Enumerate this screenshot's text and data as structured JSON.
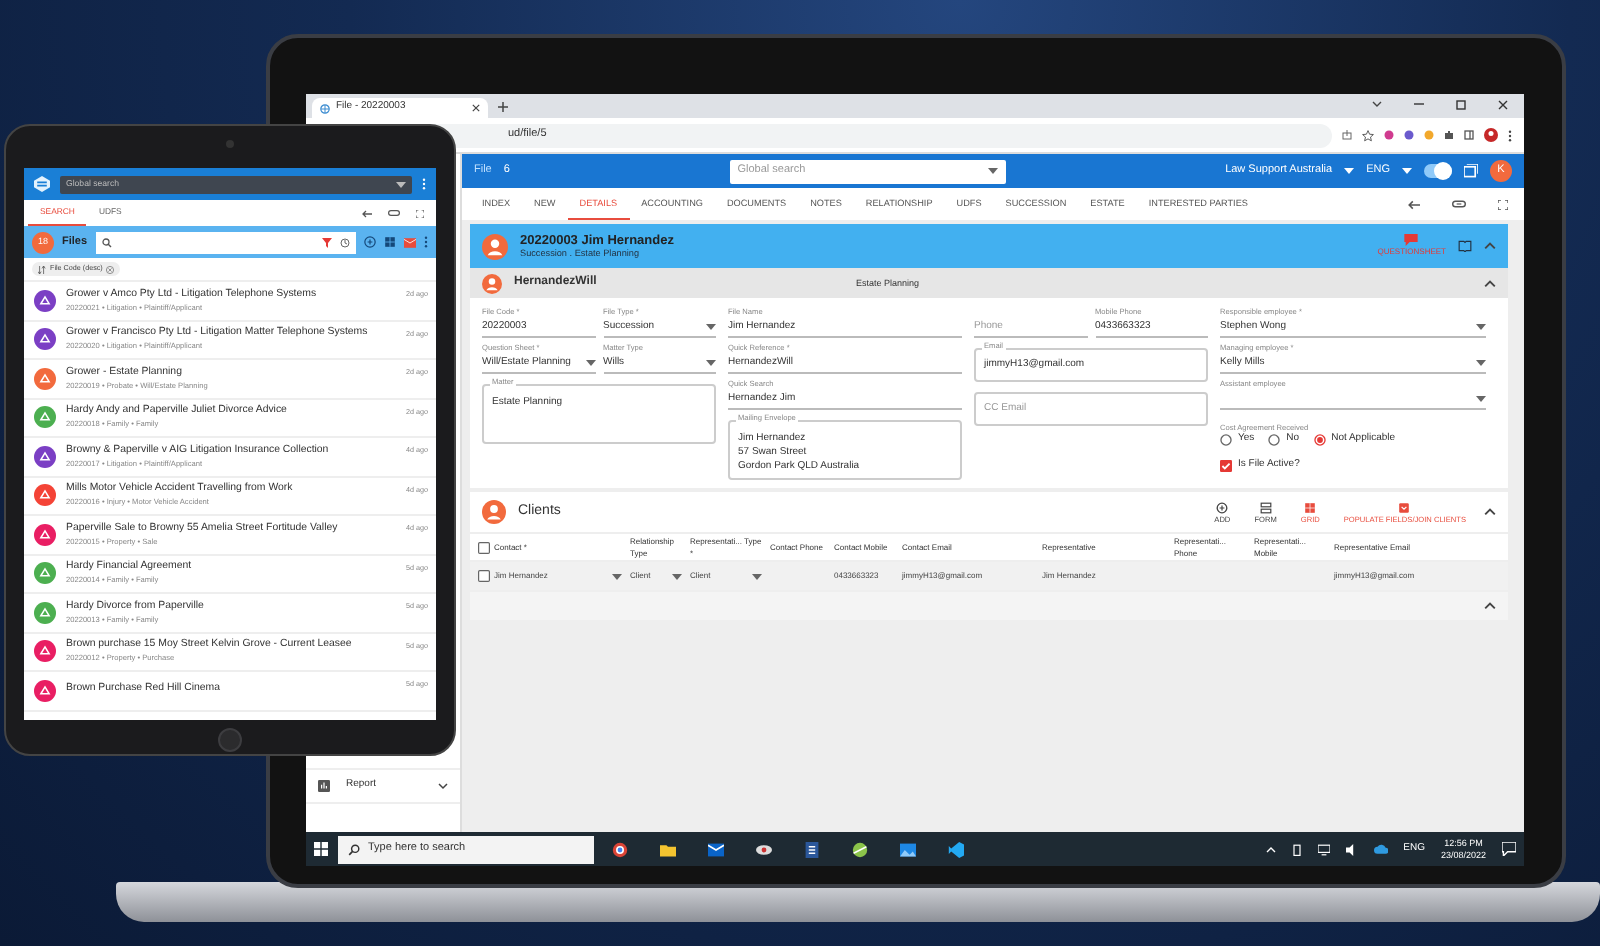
{
  "laptop": {
    "browser": {
      "tab_title": "File - 20220003",
      "address": "ud/file/5"
    },
    "app_header": {
      "title": "File",
      "count": "6",
      "search_placeholder": "Global search",
      "organization": "Law Support Australia",
      "language": "ENG",
      "toggle_on": true,
      "avatar": "K"
    },
    "tabs": [
      {
        "label": "INDEX",
        "selected": false
      },
      {
        "label": "NEW",
        "selected": false
      },
      {
        "label": "DETAILS",
        "selected": true
      },
      {
        "label": "ACCOUNTING",
        "selected": false
      },
      {
        "label": "DOCUMENTS",
        "selected": false
      },
      {
        "label": "NOTES",
        "selected": false
      },
      {
        "label": "RELATIONSHIP",
        "selected": false
      },
      {
        "label": "UDFS",
        "selected": false
      },
      {
        "label": "SUCCESSION",
        "selected": false
      },
      {
        "label": "ESTATE",
        "selected": false
      },
      {
        "label": "INTERESTED PARTIES",
        "selected": false
      }
    ],
    "file_header": {
      "title": "20220003 Jim Hernandez",
      "subtitle": "Succession . Estate Planning",
      "action": "QUESTIONSHEET"
    },
    "matter_header": {
      "title": "HernandezWill",
      "type": "Estate Planning"
    },
    "form_columns": [
      [
        {
          "kind": "pair",
          "fields": [
            {
              "kind": "line",
              "label": "File Code *",
              "value": "20220003"
            },
            {
              "kind": "select",
              "label": "File Type *",
              "value": "Succession"
            }
          ]
        },
        {
          "kind": "pair",
          "fields": [
            {
              "kind": "select",
              "label": "Question Sheet *",
              "value": "Will/Estate Planning"
            },
            {
              "kind": "select",
              "label": "Matter Type",
              "value": "Wills"
            }
          ]
        },
        {
          "kind": "textarea",
          "label": "Matter",
          "lines": [
            "Estate Planning"
          ]
        }
      ],
      [
        {
          "kind": "line",
          "label": "File Name",
          "value": "Jim Hernandez"
        },
        {
          "kind": "line",
          "label": "Quick Reference *",
          "value": "HernandezWill"
        },
        {
          "kind": "line",
          "label": "Quick Search",
          "value": "Hernandez Jim"
        },
        {
          "kind": "textarea",
          "label": "Mailing Envelope",
          "lines": [
            "Jim Hernandez",
            "57 Swan Street",
            "Gordon Park QLD Australia"
          ]
        }
      ],
      [
        {
          "kind": "pair",
          "fields": [
            {
              "kind": "line",
              "placeholder": "Phone"
            },
            {
              "kind": "line",
              "label": "Mobile Phone",
              "value": "0433663323"
            }
          ]
        },
        {
          "kind": "outlined",
          "label": "Email",
          "value": "jimmyH13@gmail.com"
        },
        {
          "kind": "outlined",
          "placeholder": "CC Email"
        }
      ],
      [
        {
          "kind": "select",
          "label": "Responsible employee *",
          "value": "Stephen Wong"
        },
        {
          "kind": "select",
          "label": "Managing employee *",
          "value": "Kelly Mills"
        },
        {
          "kind": "select",
          "label": "Assistant employee"
        },
        {
          "kind": "radios",
          "label": "Cost Agreement Received",
          "options": [
            {
              "label": "Yes",
              "selected": false
            },
            {
              "label": "No",
              "selected": false
            },
            {
              "label": "Not Applicable",
              "selected": true
            }
          ]
        },
        {
          "kind": "checkbox",
          "label": "Is File Active?",
          "checked": true
        }
      ]
    ],
    "clients": {
      "title": "Clients",
      "actions": [
        {
          "kind": "add",
          "label": "ADD",
          "active": false
        },
        {
          "kind": "form",
          "label": "FORM",
          "active": false
        },
        {
          "kind": "grid",
          "label": "GRID",
          "active": true
        },
        {
          "kind": "populate",
          "label": "POPULATE FIELDS/JOIN CLIENTS",
          "active": true
        }
      ],
      "columns": [
        "Contact *",
        "Relationship Type",
        "Representati... Type *",
        "Contact Phone",
        "Contact Mobile",
        "Contact Email",
        "Representative",
        "Representati... Phone",
        "Representati... Mobile",
        "Representative Email"
      ],
      "rows": [
        {
          "selected": false,
          "cells": [
            {
              "kind": "select",
              "text": "Jim Hernandez"
            },
            {
              "kind": "select",
              "text": "Client"
            },
            {
              "kind": "select",
              "text": "Client"
            },
            {
              "kind": "text"
            },
            {
              "kind": "text",
              "text": "0433663323"
            },
            {
              "kind": "text",
              "text": "jimmyH13@gmail.com"
            },
            {
              "kind": "text",
              "text": "Jim Hernandez"
            },
            {
              "kind": "text"
            },
            {
              "kind": "text"
            },
            {
              "kind": "text",
              "text": "jimmyH13@gmail.com"
            }
          ]
        }
      ]
    },
    "sidebar": {
      "items": [
        {
          "label": "Report"
        }
      ]
    },
    "taskbar": {
      "search_placeholder": "Type here to search",
      "language": "ENG",
      "time": "12:56 PM",
      "date": "23/08/2022"
    }
  },
  "tablet": {
    "search_placeholder": "Global search",
    "tabs": [
      {
        "label": "SEARCH",
        "selected": true
      },
      {
        "label": "UDFS",
        "selected": false
      }
    ],
    "files": {
      "count": "18",
      "title": "Files",
      "sort_chip": "File Code (desc)"
    },
    "items": [
      {
        "title": "Grower v Amco Pty Ltd - Litigation Telephone Systems",
        "subtitle": "20220021 • Litigation • Plaintiff/Applicant",
        "time": "2d ago",
        "color": "#7b3fc4"
      },
      {
        "title": "Grower v Francisco Pty Ltd - Litigation Matter Telephone Systems",
        "subtitle": "20220020 • Litigation • Plaintiff/Applicant",
        "time": "2d ago",
        "color": "#7b3fc4"
      },
      {
        "title": "Grower - Estate Planning",
        "subtitle": "20220019 • Probate • Will/Estate Planning",
        "time": "2d ago",
        "color": "#f26a3d"
      },
      {
        "title": "Hardy Andy and Paperville Juliet Divorce Advice",
        "subtitle": "20220018 • Family • Family",
        "time": "2d ago",
        "color": "#4caf50"
      },
      {
        "title": "Browny & Paperville v AIG Litigation Insurance Collection",
        "subtitle": "20220017 • Litigation • Plaintiff/Applicant",
        "time": "4d ago",
        "color": "#7b3fc4"
      },
      {
        "title": "Mills Motor Vehicle Accident Travelling from Work",
        "subtitle": "20220016 • Injury • Motor Vehicle Accident",
        "time": "4d ago",
        "color": "#f44336"
      },
      {
        "title": "Paperville Sale to Browny 55 Amelia Street Fortitude Valley",
        "subtitle": "20220015 • Property • Sale",
        "time": "4d ago",
        "color": "#e91e63"
      },
      {
        "title": "Hardy Financial Agreement",
        "subtitle": "20220014 • Family • Family",
        "time": "5d ago",
        "color": "#4caf50"
      },
      {
        "title": "Hardy Divorce from Paperville",
        "subtitle": "20220013 • Family • Family",
        "time": "5d ago",
        "color": "#4caf50"
      },
      {
        "title": "Brown purchase 15 Moy Street Kelvin Grove - Current Leasee",
        "subtitle": "20220012 • Property • Purchase",
        "time": "5d ago",
        "color": "#e91e63"
      },
      {
        "title": "Brown Purchase Red Hill Cinema",
        "time": "5d ago",
        "color": "#e91e63"
      }
    ]
  }
}
